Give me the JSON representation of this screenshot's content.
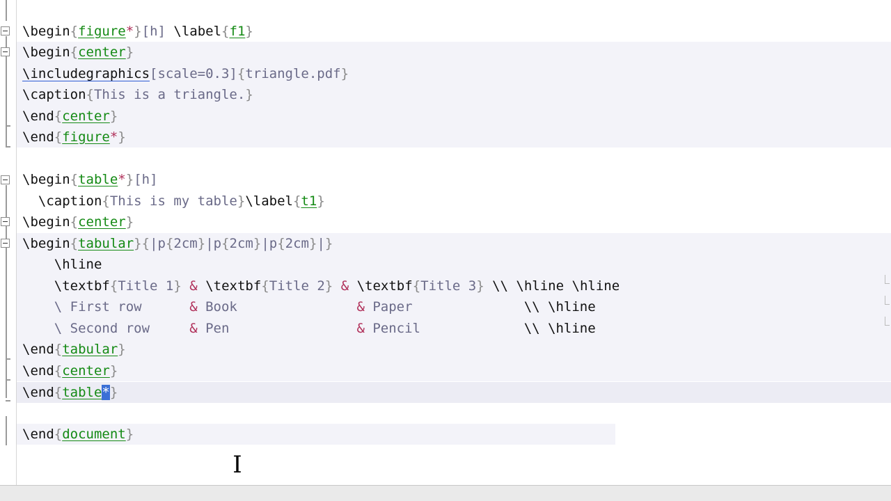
{
  "editor": {
    "lines": [
      {
        "cmd": "\\begin",
        "env": "figure",
        "star": "*",
        "opt": "[h]",
        "tail_cmd": " \\label",
        "ref": "f1"
      },
      {
        "cmd": "\\begin",
        "env": "center"
      },
      {
        "cmd": "\\includegraphics",
        "opt": "[scale=0.3]",
        "arg": "triangle.pdf"
      },
      {
        "cmd": "\\caption",
        "arg": "This is a triangle."
      },
      {
        "cmd": "\\end",
        "env": "center"
      },
      {
        "cmd": "\\end",
        "env": "figure",
        "star": "*"
      },
      {
        "cmd": "\\begin",
        "env": "table",
        "star": "*",
        "opt": "[h]"
      },
      {
        "cmd": "\\caption",
        "arg": "This is my table",
        "tail_cmd": "\\label",
        "ref": "t1"
      },
      {
        "cmd": "\\begin",
        "env": "center"
      },
      {
        "cmd": "\\begin",
        "env": "tabular",
        "arg": "|p{2cm}|p{2cm}|p{2cm}|"
      },
      {
        "text": "\\hline"
      },
      {
        "row": [
          "\\textbf{Title 1}",
          "\\textbf{Title 2}",
          "\\textbf{Title 3}"
        ],
        "end": "\\\\ \\hline \\hline"
      },
      {
        "row": [
          "\\ First row",
          "Book",
          "Paper"
        ],
        "end": "\\\\ \\hline"
      },
      {
        "row": [
          "\\ Second row",
          "Pen",
          "Pencil"
        ],
        "end": "\\\\ \\hline"
      },
      {
        "cmd": "\\end",
        "env": "tabular"
      },
      {
        "cmd": "\\end",
        "env": "center"
      },
      {
        "cmd": "\\end",
        "env": "table",
        "star": "*"
      },
      {
        "cmd": "\\end",
        "env": "document"
      }
    ],
    "texts": {
      "l1_cmd": "\\begin",
      "l1_env": "figure",
      "l1_star": "*",
      "l1_opt": "[h]",
      "l1_label": " \\label",
      "l1_ref": "f1",
      "l2_cmd": "\\begin",
      "l2_env": "center",
      "l3_cmd": "\\includegraphics",
      "l3_opt": "[scale=0.3]",
      "l3_arg": "triangle.pdf",
      "l4_cmd": "\\caption",
      "l4_arg": "This is a triangle.",
      "l5_cmd": "\\end",
      "l5_env": "center",
      "l6_cmd": "\\end",
      "l6_env": "figure",
      "l6_star": "*",
      "l8_cmd": "\\begin",
      "l8_env": "table",
      "l8_star": "*",
      "l8_opt": "[h]",
      "l9_cmd": "  \\caption",
      "l9_arg": "This is my table",
      "l9_label": "\\label",
      "l9_ref": "t1",
      "l10_cmd": "\\begin",
      "l10_env": "center",
      "l11_cmd": "\\begin",
      "l11_env": "tabular",
      "l11_a1": "|p",
      "l11_a2": "2cm",
      "l11_a3": "|p",
      "l11_a4": "2cm",
      "l11_a5": "|p",
      "l11_a6": "2cm",
      "l11_a7": "|",
      "l12_text": "    \\hline",
      "l13_c1": "    \\textbf",
      "l13_a1": "Title 1",
      "l13_c2": "\\textbf",
      "l13_a2": "Title 2",
      "l13_c3": "\\textbf",
      "l13_a3": "Title 3",
      "l13_end": " \\\\ \\hline \\hline",
      "l14_a": "    \\ First row      ",
      "l14_b": " Book               ",
      "l14_c": " Paper              ",
      "l14_end": "\\\\ \\hline",
      "l15_a": "    \\ Second row     ",
      "l15_b": " Pen                ",
      "l15_c": " Pencil             ",
      "l15_end": "\\\\ \\hline",
      "l16_cmd": "\\end",
      "l16_env": "tabular",
      "l17_cmd": "\\end",
      "l17_env": "center",
      "l18_cmd": "\\end",
      "l18_env": "table",
      "l18_sel": "*",
      "l20_cmd": "\\end",
      "l20_env": "document",
      "amp": "&",
      "ob": "{",
      "cb": "}"
    }
  },
  "colors": {
    "env_green": "#148a14",
    "star_pink": "#b0305a",
    "selection": "#3b6fd6",
    "line_highlight": "#f3f3f9"
  },
  "cursor": {
    "icon": "i-beam-cursor-icon"
  }
}
